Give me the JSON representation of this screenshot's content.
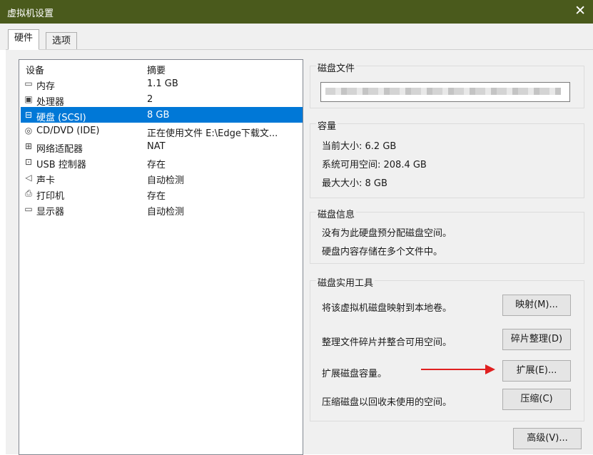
{
  "window": {
    "title": "虚拟机设置",
    "close_glyph": "✕"
  },
  "tabs": [
    {
      "label": "硬件",
      "active": true
    },
    {
      "label": "选项",
      "active": false
    }
  ],
  "device_list": {
    "headers": {
      "device": "设备",
      "summary": "摘要"
    },
    "items": [
      {
        "icon": "memory-icon",
        "name": "内存",
        "summary": "1.1 GB"
      },
      {
        "icon": "processor-icon",
        "name": "处理器",
        "summary": "2"
      },
      {
        "icon": "hard-disk-icon",
        "name": "硬盘 (SCSI)",
        "summary": "8 GB",
        "selected": true
      },
      {
        "icon": "cd-dvd-icon",
        "name": "CD/DVD (IDE)",
        "summary": "正在使用文件 E:\\Edge下载文..."
      },
      {
        "icon": "network-adapter-icon",
        "name": "网络适配器",
        "summary": "NAT"
      },
      {
        "icon": "usb-controller-icon",
        "name": "USB 控制器",
        "summary": "存在"
      },
      {
        "icon": "sound-card-icon",
        "name": "声卡",
        "summary": "自动检测"
      },
      {
        "icon": "printer-icon",
        "name": "打印机",
        "summary": "存在"
      },
      {
        "icon": "display-icon",
        "name": "显示器",
        "summary": "自动检测"
      }
    ]
  },
  "disk_file": {
    "legend": "磁盘文件"
  },
  "capacity": {
    "legend": "容量",
    "current_size": "当前大小: 6.2 GB",
    "system_free": "系统可用空间: 208.4 GB",
    "max_size": "最大大小: 8 GB"
  },
  "disk_info": {
    "legend": "磁盘信息",
    "line1": "没有为此硬盘预分配磁盘空间。",
    "line2": "硬盘内容存储在多个文件中。"
  },
  "disk_utilities": {
    "legend": "磁盘实用工具",
    "map_text": "将该虚拟机磁盘映射到本地卷。",
    "map_button": "映射(M)...",
    "defrag_text": "整理文件碎片并整合可用空间。",
    "defrag_button": "碎片整理(D)",
    "expand_text": "扩展磁盘容量。",
    "expand_button": "扩展(E)...",
    "compact_text": "压缩磁盘以回收未使用的空间。",
    "compact_button": "压缩(C)"
  },
  "advanced_button": "高级(V)...",
  "colors": {
    "titlebar": "#4a5a1c",
    "selection": "#0078d7",
    "annotation_arrow": "#e02020"
  }
}
